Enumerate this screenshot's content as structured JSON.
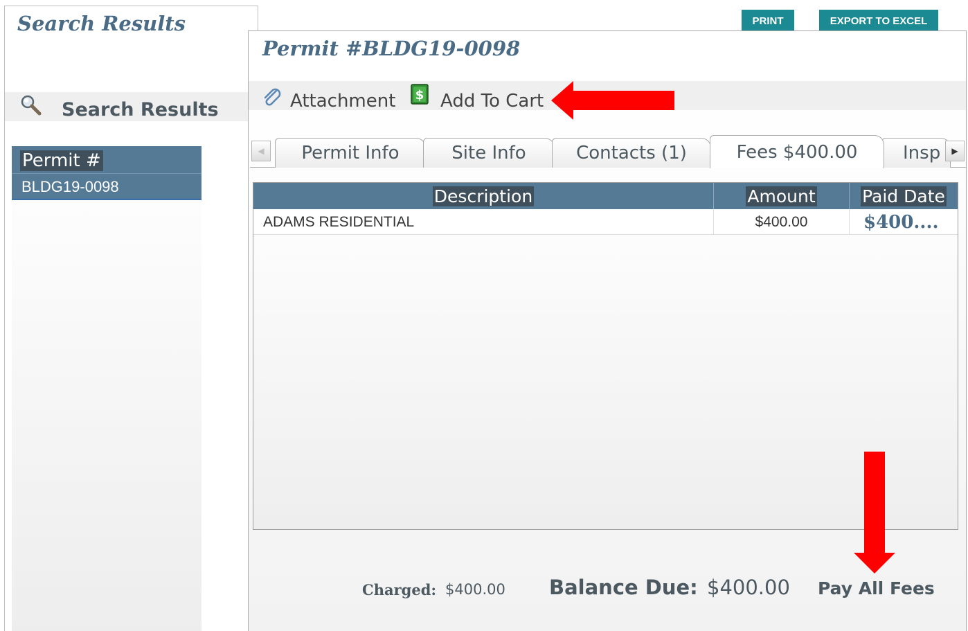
{
  "left_panel": {
    "title": "Search Results",
    "section_label": "Search Results",
    "column_header": "Permit #",
    "rows": [
      {
        "permit": "BLDG19-0098"
      }
    ]
  },
  "top_actions": {
    "print_label": "PRINT",
    "export_label": "EXPORT TO EXCEL"
  },
  "detail": {
    "title": "Permit #BLDG19-0098",
    "toolbar": {
      "attachment_label": "Attachment",
      "add_to_cart_label": "Add To Cart"
    },
    "tabs": [
      {
        "label": "Permit Info"
      },
      {
        "label": "Site Info"
      },
      {
        "label": "Contacts (1)"
      },
      {
        "label": "Fees $400.00",
        "active": true
      },
      {
        "label": "Insp"
      }
    ],
    "fees_table": {
      "columns": [
        "Description",
        "Amount",
        "Paid Date"
      ],
      "rows": [
        {
          "description": "ADAMS RESIDENTIAL",
          "amount": "$400.00",
          "paid_date": "$400...."
        }
      ]
    },
    "totals": {
      "charged_label": "Charged:",
      "charged_value": "$400.00",
      "balance_label": "Balance Due:",
      "balance_value": "$400.00",
      "pay_all_label": "Pay All Fees"
    }
  },
  "colors": {
    "header_blue": "#557a95",
    "title_blue": "#4a6b85",
    "button_teal": "#1b8a93",
    "annotation_red": "#ff0000"
  },
  "icons": {
    "search": "magnifier-icon",
    "attachment": "paperclip-icon",
    "cart": "dollar-icon"
  }
}
